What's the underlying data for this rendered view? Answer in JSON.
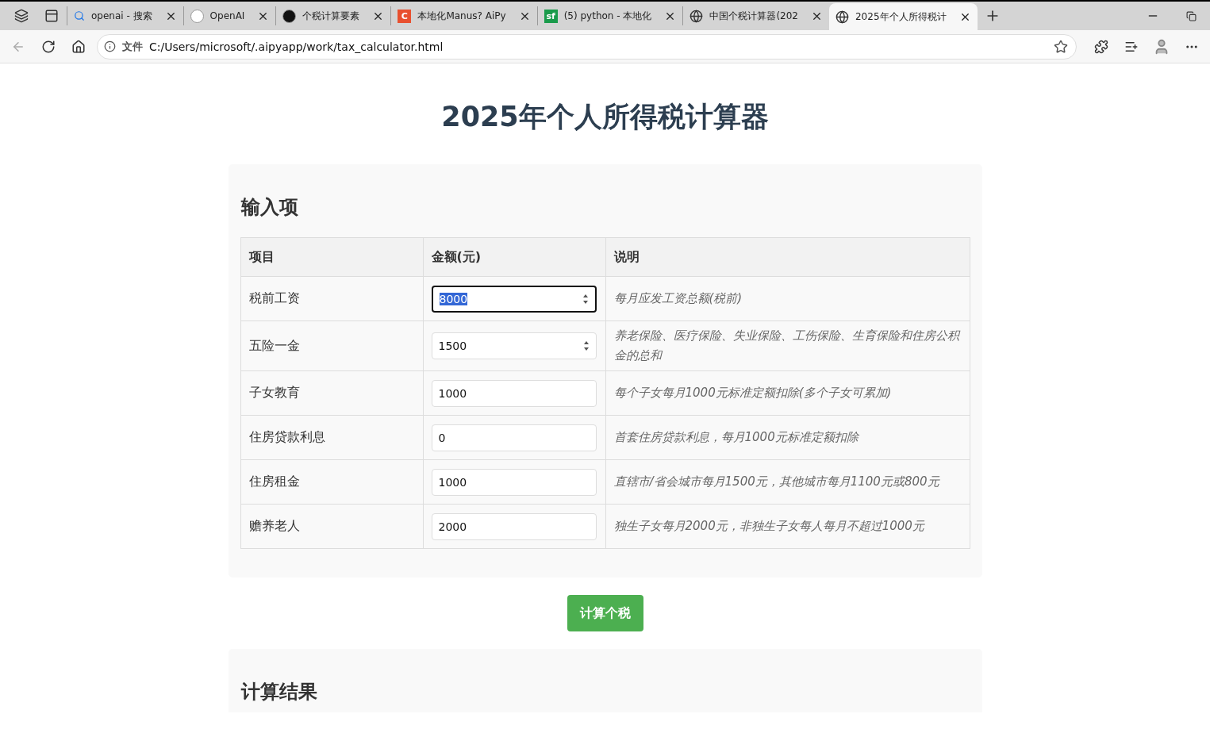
{
  "browser": {
    "tabs": [
      {
        "title": "openai - 搜索",
        "selected": false
      },
      {
        "title": "OpenAI",
        "selected": false
      },
      {
        "title": "个税计算要素",
        "selected": false
      },
      {
        "logo_text": "C",
        "title": "本地化Manus? AiPy",
        "selected": false
      },
      {
        "logo_text": "sf",
        "title": "(5) python - 本地化",
        "selected": false
      },
      {
        "title": "中国个税计算器(202",
        "selected": false
      },
      {
        "title": "2025年个人所得税计",
        "selected": true
      }
    ],
    "address": {
      "badge": "文件",
      "url": "C:/Users/microsoft/.aipyapp/work/tax_calculator.html"
    }
  },
  "page": {
    "title": "2025年个人所得税计算器",
    "input_section": {
      "heading": "输入项",
      "columns": [
        "项目",
        "金额(元)",
        "说明"
      ],
      "rows": [
        {
          "item": "税前工资",
          "value": "8000",
          "focused": true,
          "spinner": true,
          "note": "每月应发工资总额(税前)"
        },
        {
          "item": "五险一金",
          "value": "1500",
          "focused": false,
          "spinner": true,
          "note": "养老保险、医疗保险、失业保险、工伤保险、生育保险和住房公积金的总和"
        },
        {
          "item": "子女教育",
          "value": "1000",
          "focused": false,
          "spinner": false,
          "note": "每个子女每月1000元标准定额扣除(多个子女可累加)"
        },
        {
          "item": "住房贷款利息",
          "value": "0",
          "focused": false,
          "spinner": false,
          "note": "首套住房贷款利息，每月1000元标准定额扣除"
        },
        {
          "item": "住房租金",
          "value": "1000",
          "focused": false,
          "spinner": false,
          "note": "直辖市/省会城市每月1500元，其他城市每月1100元或800元"
        },
        {
          "item": "赡养老人",
          "value": "2000",
          "focused": false,
          "spinner": false,
          "note": "独生子女每月2000元，非独生子女每人每月不超过1000元"
        }
      ]
    },
    "calculate_button": "计算个税",
    "result_section": {
      "heading": "计算结果"
    }
  }
}
